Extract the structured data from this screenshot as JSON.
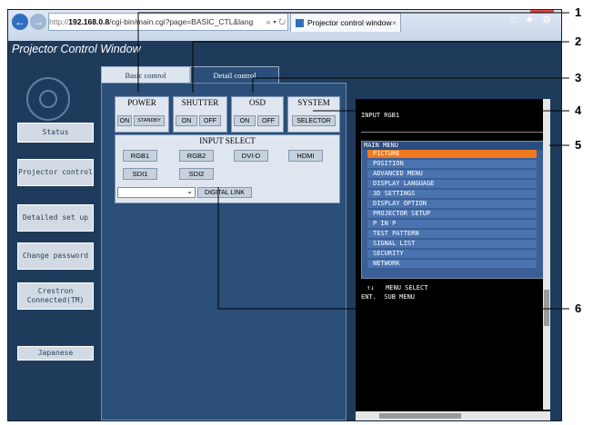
{
  "browser": {
    "address_prefix": "http://",
    "address_host": "192.168.0.8",
    "address_path": "/cgi-bin/main.cgi?page=BASIC_CTL&lang",
    "address_controls": "⌕ ▾ ↻",
    "tab_title": "Projector control window",
    "tab_close": "×",
    "right_icons": "⌂ ★ ⚙"
  },
  "app": {
    "title": "Projector Control Window"
  },
  "tabs": {
    "basic": "Basic control",
    "detail": "Detail control"
  },
  "sidebar": {
    "items": [
      {
        "label": "Status"
      },
      {
        "label": "Projector control"
      },
      {
        "label": "Detailed set up"
      },
      {
        "label": "Change password"
      },
      {
        "label": "Crestron Connected(TM)"
      },
      {
        "label": "Japanese"
      }
    ]
  },
  "controls": {
    "power": {
      "title": "POWER",
      "on": "ON",
      "standby": "STANDBY"
    },
    "shutter": {
      "title": "SHUTTER",
      "on": "ON",
      "off": "OFF"
    },
    "osd": {
      "title": "OSD",
      "on": "ON",
      "off": "OFF"
    },
    "system": {
      "title": "SYSTEM",
      "selector": "SELECTOR"
    },
    "input_select": {
      "title": "INPUT SELECT",
      "buttons": [
        "RGB1",
        "RGB2",
        "DVI-D",
        "HDMI",
        "SDI1",
        "SDI2"
      ],
      "dropdown_value": "",
      "digital_link": "DIGITAL LINK"
    }
  },
  "osd_panel": {
    "input_label": "INPUT RGB1",
    "main_menu_title": "MAIN MENU",
    "menu_items": [
      "PICTURE",
      "POSITION",
      "ADVANCED MENU",
      "DISPLAY LANGUAGE",
      "3D SETTINGS",
      "DISPLAY OPTION",
      "PROJECTOR SETUP",
      "P IN P",
      "TEST PATTERN",
      "SIGNAL LIST",
      "SECURITY",
      "NETWORK"
    ],
    "selected_index": 0,
    "footer_line1": "↑↓   MENU SELECT",
    "footer_line2": "ENT.  SUB MENU"
  },
  "callouts": [
    "1",
    "2",
    "3",
    "4",
    "5",
    "6"
  ],
  "colors": {
    "accent_selected": "#ef7a1e",
    "menu_item": "#4a73b0",
    "window_bg": "#1f3b5c",
    "callout_line": "#000000"
  }
}
